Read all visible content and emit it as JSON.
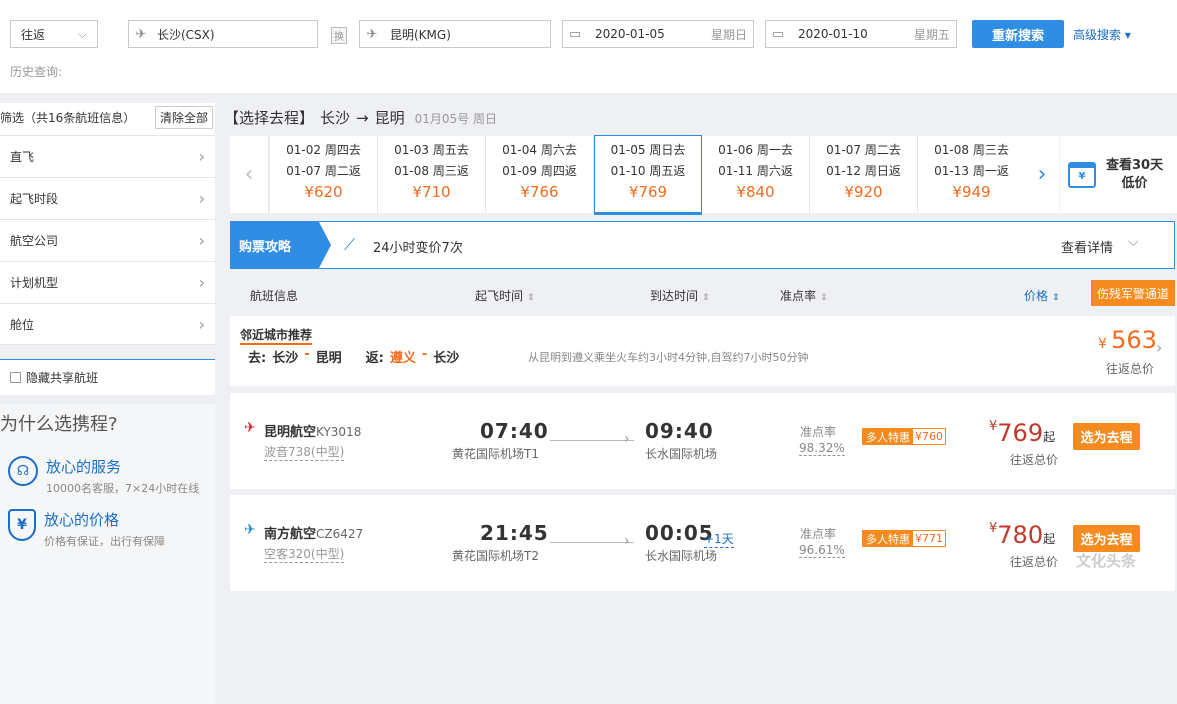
{
  "search": {
    "trip_type": "往返",
    "from": "长沙(CSX)",
    "swap": "换",
    "to": "昆明(KMG)",
    "depart_date": "2020-01-05",
    "depart_weekday": "星期日",
    "return_date": "2020-01-10",
    "return_weekday": "星期五",
    "search_btn": "重新搜索",
    "advanced": "高级搜索",
    "history": "历史查询:"
  },
  "sidebar": {
    "filter_title": "筛选（共16条航班信息）",
    "clear_all": "清除全部",
    "items": [
      "直飞",
      "起飞时段",
      "航空公司",
      "计划机型",
      "舱位"
    ],
    "hide_shared": "隐藏共享航班",
    "why_title": "为什么选携程?",
    "perks": [
      {
        "title": "放心的服务",
        "desc": "10000名客服，7×24小时在线"
      },
      {
        "title": "放心的价格",
        "desc": "价格有保证，出行有保障"
      }
    ]
  },
  "route": {
    "bracket_label": "【选择去程】",
    "from": "长沙",
    "arrow": "→",
    "to": "昆明",
    "date": "01月05号 周日"
  },
  "date_strip": [
    {
      "go": "01-02 周四去",
      "ret": "01-07 周二返",
      "price": "¥620"
    },
    {
      "go": "01-03 周五去",
      "ret": "01-08 周三返",
      "price": "¥710"
    },
    {
      "go": "01-04 周六去",
      "ret": "01-09 周四返",
      "price": "¥766"
    },
    {
      "go": "01-05 周日去",
      "ret": "01-10 周五返",
      "price": "¥769"
    },
    {
      "go": "01-06 周一去",
      "ret": "01-11 周六返",
      "price": "¥840"
    },
    {
      "go": "01-07 周二去",
      "ret": "01-12 周日返",
      "price": "¥920"
    },
    {
      "go": "01-08 周三去",
      "ret": "01-13 周一返",
      "price": "¥949"
    }
  ],
  "calendar30": {
    "line1": "查看30天",
    "line2": "低价"
  },
  "guide": {
    "label": "购票攻略",
    "info": "24小时变价7次",
    "details": "查看详情"
  },
  "columns": {
    "flight": "航班信息",
    "depart": "起飞时间",
    "arrive": "到达时间",
    "ontime": "准点率",
    "price": "价格",
    "military": "伤残军警通道"
  },
  "nearby": {
    "title": "邻近城市推荐",
    "go_label": "去:",
    "go_from": "长沙",
    "go_to": "昆明",
    "ret_label": "返:",
    "ret_from": "遵义",
    "ret_to": "长沙",
    "dash": "-",
    "note": "从昆明到遵义乘坐火车约3小时4分钟,自驾约7小时50分钟",
    "currency": "¥",
    "price": "563",
    "price_note": "往返总价"
  },
  "flights": [
    {
      "airline": "昆明航空",
      "code": "KY3018",
      "plane": "波音738(中型)",
      "dep_time": "07:40",
      "dep_airport": "黄花国际机场T1",
      "arr_time": "09:40",
      "arr_airport": "长水国际机场",
      "plus_day": "",
      "ontime_label": "准点率",
      "ontime": "98.32%",
      "tag_a": "多人特惠",
      "tag_b": "¥760",
      "currency": "¥",
      "price": "769",
      "qi": "起",
      "total": "往返总价",
      "pick": "选为去程",
      "logo_color": "#d2262a"
    },
    {
      "airline": "南方航空",
      "code": "CZ6427",
      "plane": "空客320(中型)",
      "dep_time": "21:45",
      "dep_airport": "黄花国际机场T2",
      "arr_time": "00:05",
      "arr_airport": "长水国际机场",
      "plus_day": "+1天",
      "ontime_label": "准点率",
      "ontime": "96.61%",
      "tag_a": "多人特惠",
      "tag_b": "¥771",
      "currency": "¥",
      "price": "780",
      "qi": "起",
      "total": "往返总价",
      "pick": "选为去程",
      "logo_color": "#1e88d0"
    }
  ],
  "watermark": "文化头条"
}
